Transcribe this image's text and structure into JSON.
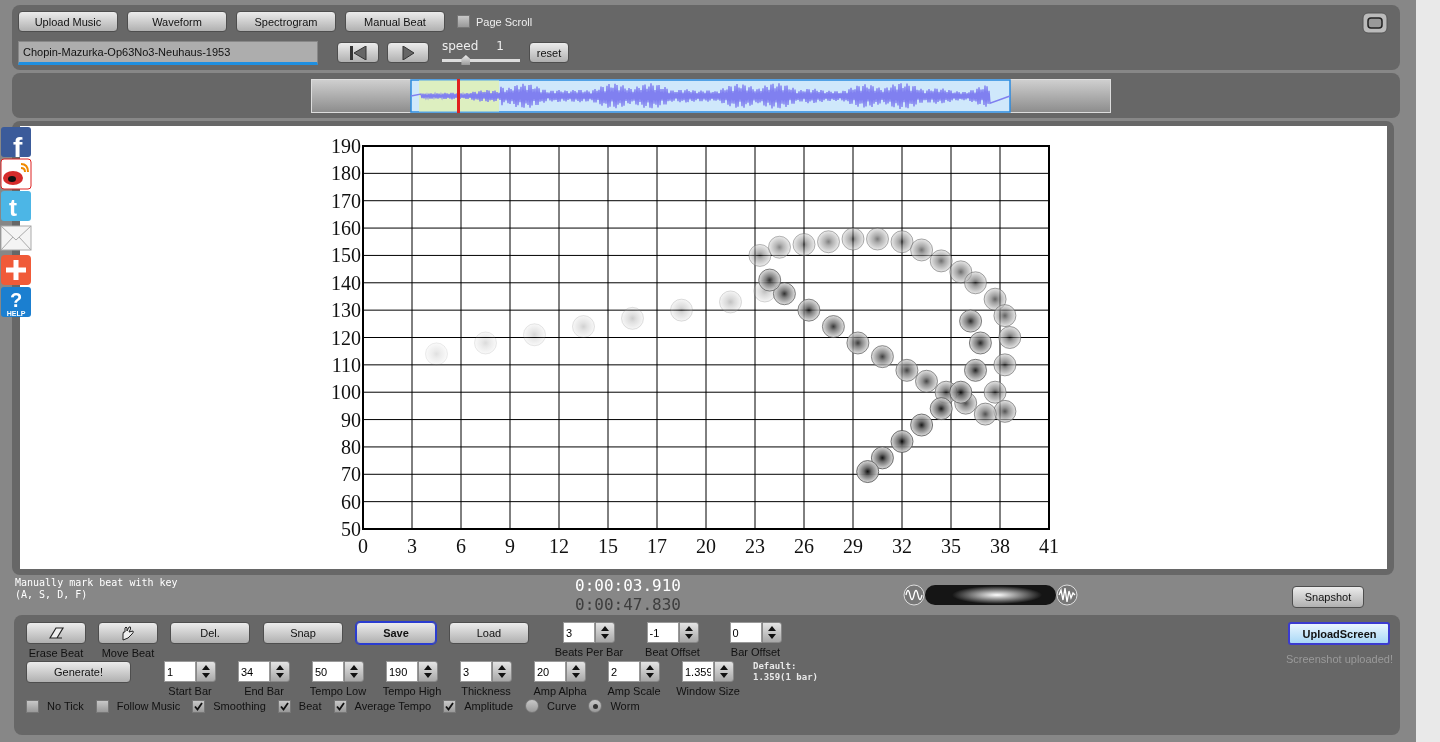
{
  "toolbar": {
    "buttons": [
      {
        "label": "Upload Music"
      },
      {
        "label": "Waveform"
      },
      {
        "label": "Spectrogram"
      },
      {
        "label": "Manual Beat"
      }
    ],
    "page_scroll": {
      "label": "Page Scroll",
      "checked": false
    },
    "file_name": "Chopin-Mazurka-Op63No3-Neuhaus-1953",
    "speed": {
      "label": "speed",
      "value": "1",
      "level": 0.3
    },
    "reset_button": "reset"
  },
  "social_icons": [
    {
      "kind": "facebook",
      "glyph": "f"
    },
    {
      "kind": "weibo"
    },
    {
      "kind": "twitter",
      "glyph": "t"
    },
    {
      "kind": "mail"
    },
    {
      "kind": "share"
    },
    {
      "kind": "help",
      "glyph": "?",
      "label": "HELP"
    }
  ],
  "chart": {
    "y_labels": [
      "190",
      "180",
      "170",
      "160",
      "150",
      "140",
      "130",
      "120",
      "110",
      "100",
      "90",
      "80",
      "70",
      "60",
      "50"
    ],
    "x_labels": [
      "0",
      "3",
      "6",
      "9",
      "12",
      "15",
      "17",
      "20",
      "23",
      "26",
      "29",
      "32",
      "35",
      "38",
      "41"
    ]
  },
  "status": {
    "hint": "Manually mark beat with key\n(A, S, D, F)",
    "time_current": "0:00:03.910",
    "time_total": "0:00:47.830",
    "volume": {
      "level": 0.55
    },
    "snapshot_button": "Snapshot"
  },
  "controls": {
    "buttons": [
      {
        "kind": "eraser",
        "label": "Erase Beat",
        "focused": false
      },
      {
        "kind": "move",
        "label": "Move Beat",
        "focused": false
      },
      {
        "kind": "text",
        "label": "Del.",
        "focused": false
      },
      {
        "kind": "text",
        "label": "Snap",
        "focused": false
      },
      {
        "kind": "text",
        "label": "Save",
        "focused": true
      },
      {
        "kind": "text",
        "label": "Load",
        "focused": false
      }
    ],
    "top_fields": [
      {
        "label": "Beats Per Bar",
        "value": "3"
      },
      {
        "label": "Beat Offset",
        "value": "-1"
      },
      {
        "label": "Bar Offset",
        "value": "0"
      }
    ],
    "generate_button": "Generate!",
    "fields": [
      {
        "label": "Start Bar",
        "value": "1"
      },
      {
        "label": "End Bar",
        "value": "34"
      },
      {
        "label": "Tempo Low",
        "value": "50"
      },
      {
        "label": "Tempo High",
        "value": "190"
      },
      {
        "label": "Thickness",
        "value": "3"
      },
      {
        "label": "Amp Alpha",
        "value": "20"
      },
      {
        "label": "Amp Scale",
        "value": "2"
      },
      {
        "label": "Window Size",
        "value": "1.359"
      }
    ],
    "window_default_note": "Default:\n1.359(1 bar)",
    "options": [
      {
        "kind": "checkbox",
        "label": "No Tick",
        "checked": false
      },
      {
        "kind": "checkbox",
        "label": "Follow Music",
        "checked": false
      },
      {
        "kind": "checkbox",
        "label": "Smoothing",
        "checked": true
      },
      {
        "kind": "checkbox",
        "label": "Beat",
        "checked": true
      },
      {
        "kind": "checkbox",
        "label": "Average Tempo",
        "checked": true
      },
      {
        "kind": "checkbox",
        "label": "Amplitude",
        "checked": true
      },
      {
        "kind": "radio",
        "label": "Curve",
        "selected": false
      },
      {
        "kind": "radio",
        "label": "Worm",
        "selected": true
      }
    ],
    "upload_button": "UploadScreen",
    "upload_message": "Screenshot uploaded!"
  }
}
